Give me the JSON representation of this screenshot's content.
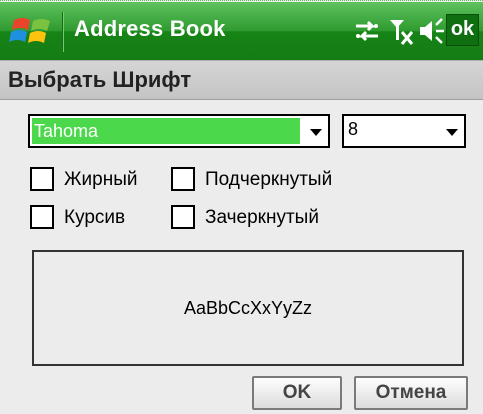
{
  "titlebar": {
    "app_title": "Address Book",
    "ok_label": "ok"
  },
  "dialog": {
    "title": "Выбрать Шрифт"
  },
  "font": {
    "selected": "Tahoma"
  },
  "size": {
    "selected": "8"
  },
  "options": {
    "bold": {
      "label": "Жирный",
      "checked": false
    },
    "underline": {
      "label": "Подчеркнутый",
      "checked": false
    },
    "italic": {
      "label": "Курсив",
      "checked": false
    },
    "strikeout": {
      "label": "Зачеркнутый",
      "checked": false
    }
  },
  "preview": {
    "sample_text": "AaBbCcXxYyZz"
  },
  "buttons": {
    "ok": "OK",
    "cancel": "Отмена"
  },
  "colors": {
    "titlebar": "#2f9a2f",
    "selection": "#4bd84b",
    "background": "#ececec"
  }
}
